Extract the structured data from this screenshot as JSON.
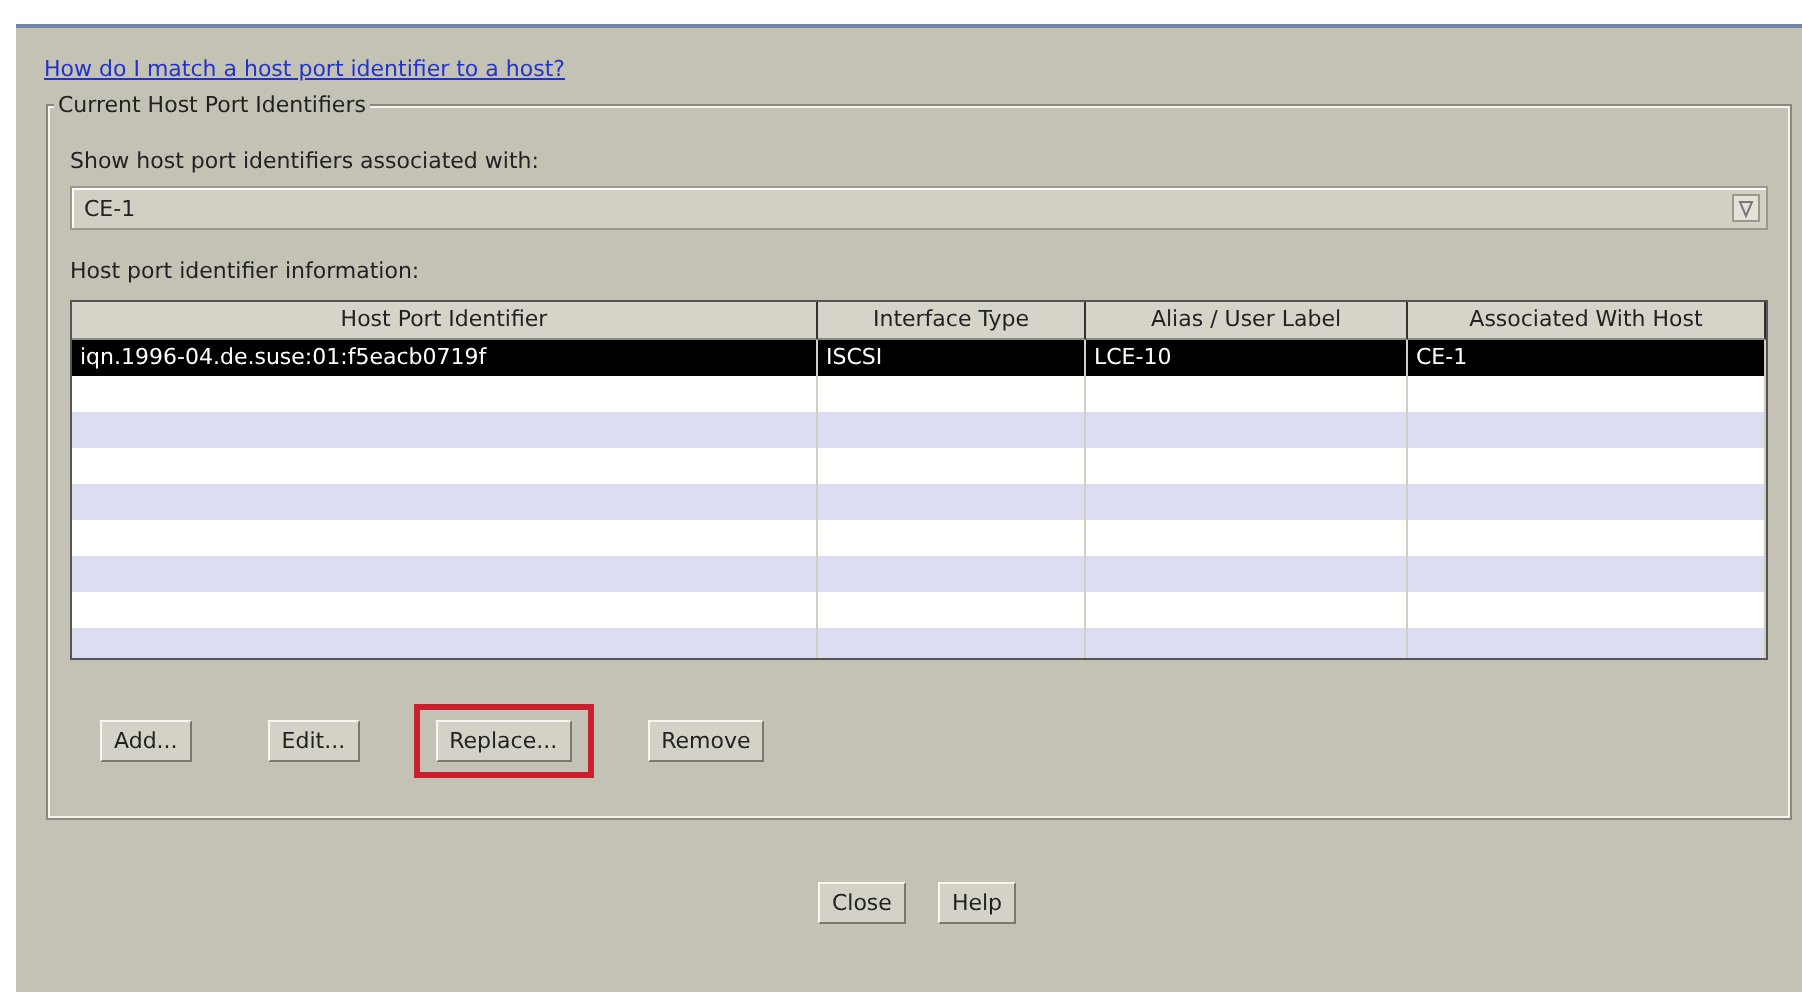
{
  "help_link": "How do I match a host port identifier to a host?",
  "group": {
    "title": "Current Host Port Identifiers",
    "filter_label": "Show host port identifiers associated with:",
    "filter_value": "CE-1",
    "table_label": "Host port identifier information:",
    "table": {
      "columns": [
        "Host Port Identifier",
        "Interface Type",
        "Alias / User Label",
        "Associated With Host"
      ],
      "rows": [
        {
          "cells": [
            "iqn.1996-04.de.suse:01:f5eacb0719f",
            "ISCSI",
            "LCE-10",
            "CE-1"
          ],
          "selected": true
        }
      ]
    },
    "buttons": [
      {
        "label": "Add...",
        "highlighted": false
      },
      {
        "label": "Edit...",
        "highlighted": false
      },
      {
        "label": "Replace...",
        "highlighted": true
      },
      {
        "label": "Remove",
        "highlighted": false
      }
    ]
  },
  "footer_buttons": [
    "Close",
    "Help"
  ]
}
